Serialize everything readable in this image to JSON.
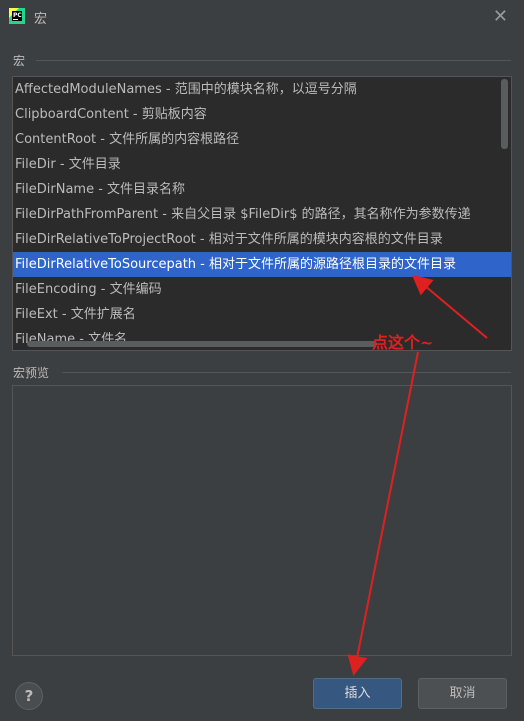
{
  "window": {
    "title": "宏",
    "close_icon": "close-icon",
    "app_icon": "pycharm-icon"
  },
  "macros_section": {
    "label": "宏",
    "items": [
      {
        "name": "AffectedModuleNames",
        "desc": " - 范围中的模块名称，以逗号分隔",
        "selected": false
      },
      {
        "name": "ClipboardContent",
        "desc": " - 剪贴板内容",
        "selected": false
      },
      {
        "name": "ContentRoot",
        "desc": " - 文件所属的内容根路径",
        "selected": false
      },
      {
        "name": "FileDir",
        "desc": " - 文件目录",
        "selected": false
      },
      {
        "name": "FileDirName",
        "desc": " - 文件目录名称",
        "selected": false
      },
      {
        "name": "FileDirPathFromParent",
        "desc": " - 来自父目录 $FileDir$ 的路径，其名称作为参数传递",
        "selected": false
      },
      {
        "name": "FileDirRelativeToProjectRoot",
        "desc": " - 相对于文件所属的模块内容根的文件目录",
        "selected": false
      },
      {
        "name": "FileDirRelativeToSourcepath",
        "desc": " - 相对于文件所属的源路径根目录的文件目录",
        "selected": true
      },
      {
        "name": "FileEncoding",
        "desc": " - 文件编码",
        "selected": false
      },
      {
        "name": "FileExt",
        "desc": " - 文件扩展名",
        "selected": false
      },
      {
        "name": "FileName",
        "desc": " - 文件名",
        "selected": false
      }
    ]
  },
  "preview_section": {
    "label": "宏预览"
  },
  "footer": {
    "help_label": "?",
    "insert_label": "插入",
    "cancel_label": "取消"
  },
  "annotation": {
    "text": "点这个~",
    "color": "#e02020"
  },
  "colors": {
    "background": "#3c3f41",
    "list_background": "#2b2b2b",
    "selection": "#2f65ca",
    "primary_button": "#365880"
  }
}
